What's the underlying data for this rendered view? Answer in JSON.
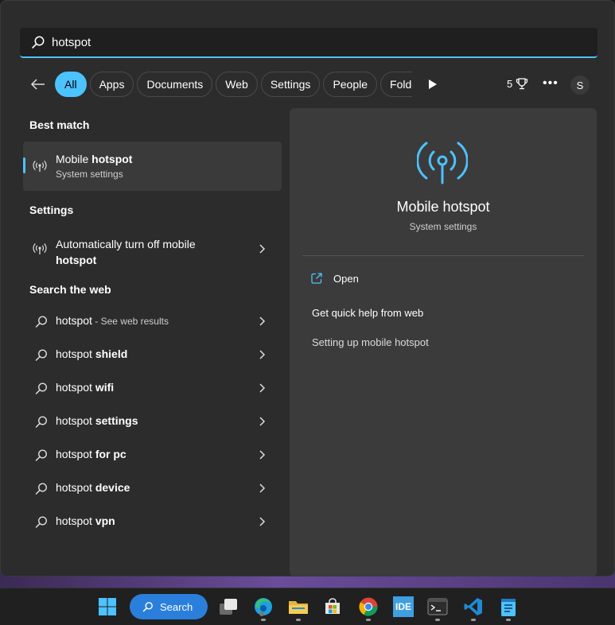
{
  "search": {
    "value": "hotspot"
  },
  "filters": [
    {
      "label": "All",
      "active": true
    },
    {
      "label": "Apps"
    },
    {
      "label": "Documents"
    },
    {
      "label": "Web"
    },
    {
      "label": "Settings"
    },
    {
      "label": "People"
    },
    {
      "label": "Folders"
    }
  ],
  "header": {
    "rewards_points": "5",
    "avatar_initial": "S"
  },
  "best_match": {
    "heading": "Best match",
    "title_plain": "Mobile ",
    "title_bold": "hotspot",
    "subtitle": "System settings"
  },
  "settings_section": {
    "heading": "Settings",
    "item_plain": "Automatically turn off mobile",
    "item_bold": "hotspot"
  },
  "web_section": {
    "heading": "Search the web",
    "items": [
      {
        "plain": "hotspot",
        "bold": "",
        "sub": " - See web results"
      },
      {
        "plain": "hotspot ",
        "bold": "shield",
        "sub": ""
      },
      {
        "plain": "hotspot ",
        "bold": "wifi",
        "sub": ""
      },
      {
        "plain": "hotspot ",
        "bold": "settings",
        "sub": ""
      },
      {
        "plain": "hotspot ",
        "bold": "for pc",
        "sub": ""
      },
      {
        "plain": "hotspot ",
        "bold": "device",
        "sub": ""
      },
      {
        "plain": "hotspot ",
        "bold": "vpn",
        "sub": ""
      }
    ]
  },
  "preview": {
    "title": "Mobile hotspot",
    "subtitle": "System settings",
    "open_label": "Open",
    "help_heading": "Get quick help from web",
    "help_link": "Setting up mobile hotspot"
  },
  "taskbar": {
    "search_label": "Search",
    "apps": [
      "start-icon",
      "task-view-icon",
      "edge-icon",
      "file-explorer-icon",
      "store-icon",
      "chrome-icon",
      "ide-icon",
      "terminal-icon",
      "vscode-icon",
      "notepad-icon"
    ],
    "ide_text": "IDE"
  },
  "colors": {
    "accent": "#4cc2ff",
    "panel": "#2c2c2c",
    "preview": "#3b3b3b",
    "taskbar_search": "#2a7fdc"
  }
}
